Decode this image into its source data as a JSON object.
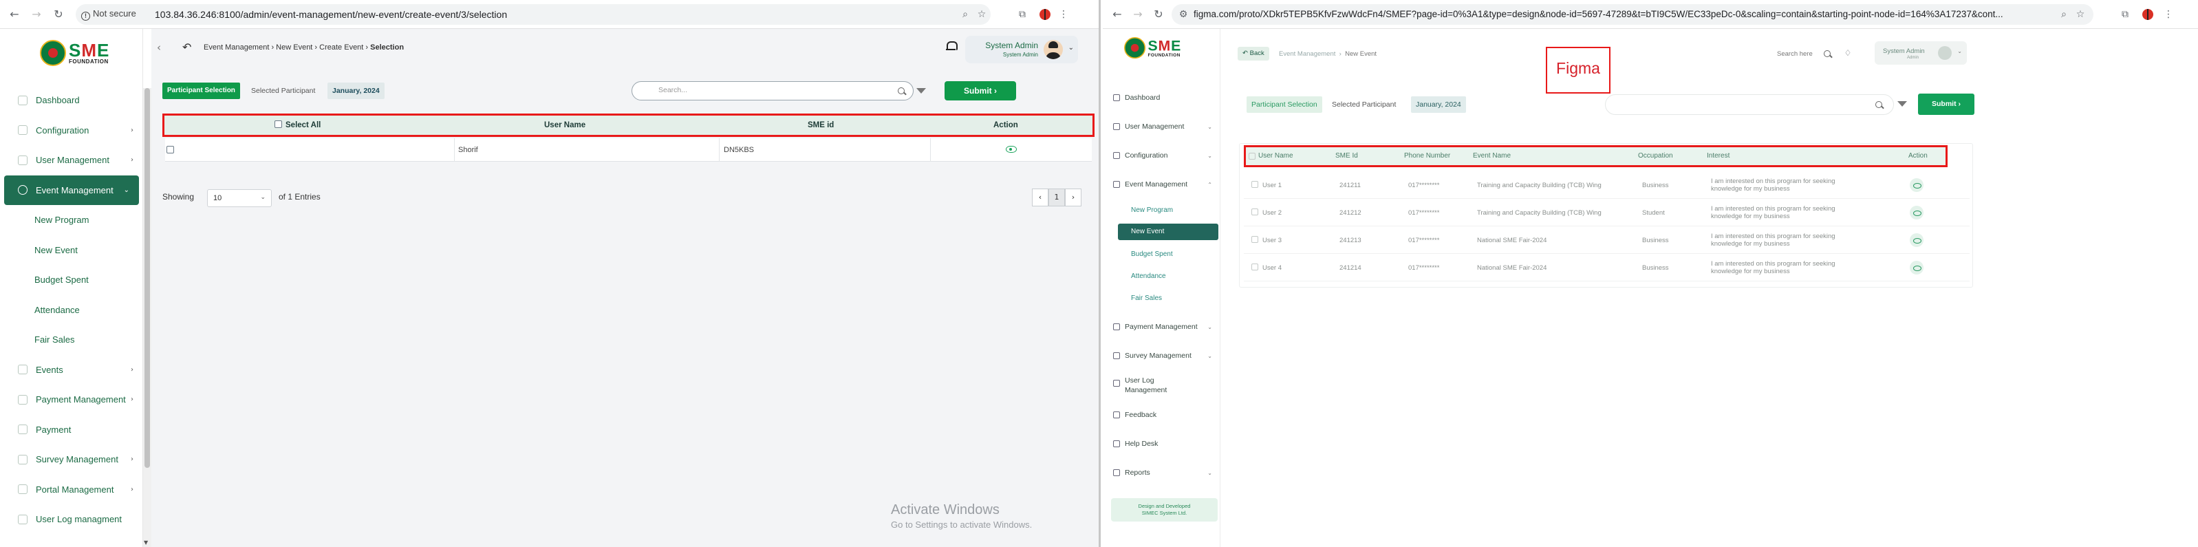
{
  "left_window": {
    "browser": {
      "security": "Not secure",
      "url": "103.84.36.246:8100/admin/event-management/new-event/create-event/3/selection"
    },
    "logo": {
      "brand": "SME",
      "tagline": "FOUNDATION"
    },
    "sidebar": {
      "items": [
        {
          "label": "Dashboard"
        },
        {
          "label": "Configuration",
          "chevron": "›"
        },
        {
          "label": "User Management",
          "chevron": "›"
        },
        {
          "label": "Event Management",
          "chevron": "⌄",
          "active": true
        }
      ],
      "subitems": [
        "New Program",
        "New Event",
        "Budget Spent",
        "Attendance",
        "Fair Sales"
      ],
      "items_after": [
        {
          "label": "Events",
          "chevron": "›"
        },
        {
          "label": "Payment Management",
          "chevron": "›"
        },
        {
          "label": "Payment"
        },
        {
          "label": "Survey Management",
          "chevron": "›"
        },
        {
          "label": "Portal Management",
          "chevron": "›"
        },
        {
          "label": "User Log managment"
        }
      ]
    },
    "header": {
      "breadcrumb": [
        "Event Management",
        "New Event",
        "Create Event",
        "Selection"
      ],
      "user_name": "System Admin",
      "user_role": "System Admin"
    },
    "tabs": {
      "participant_selection": "Participant Selection",
      "selected_participant": "Selected Participant",
      "date": "January, 2024"
    },
    "search": {
      "placeholder": "Search..."
    },
    "submit_label": "Submit",
    "table": {
      "select_all": "Select All",
      "columns": [
        "User Name",
        "SME id",
        "Action"
      ],
      "rows": [
        {
          "user_name": "Shorif",
          "sme_id": "DN5KBS"
        }
      ]
    },
    "pagination": {
      "showing_label": "Showing",
      "page_size": "10",
      "entries_text": "of 1 Entries",
      "current_page": "1"
    },
    "watermark": {
      "line1": "Activate Windows",
      "line2": "Go to Settings to activate Windows."
    }
  },
  "right_window": {
    "browser": {
      "url": "figma.com/proto/XDkr5TEPB5KfvFzwWdcFn4/SMEF?page-id=0%3A1&type=design&node-id=5697-47289&t=bTI9C5W/EC33peDc-0&scaling=contain&starting-point-node-id=164%3A17237&cont..."
    },
    "logo": {
      "brand": "SME",
      "tagline": "FOUNDATION"
    },
    "sidebar": {
      "items": [
        {
          "label": "Dashboard"
        },
        {
          "label": "User Management",
          "chevron": "⌄"
        },
        {
          "label": "Configuration",
          "chevron": "⌄"
        },
        {
          "label": "Event Management",
          "chevron": "⌃"
        }
      ],
      "subitems": [
        "New Program",
        "New Event",
        "Budget Spent",
        "Attendance",
        "Fair Sales"
      ],
      "active_subitem": "New Event",
      "items_after": [
        {
          "label": "Payment Management",
          "chevron": "⌄"
        },
        {
          "label": "Survey Management",
          "chevron": "⌄"
        },
        {
          "label": "User Log Management"
        },
        {
          "label": "Feedback"
        },
        {
          "label": "Help Desk"
        },
        {
          "label": "Reports",
          "chevron": "⌄"
        }
      ],
      "footer_line1": "Design and Developed",
      "footer_line2": "SIMEC System Ltd."
    },
    "header": {
      "back_label": "Back",
      "breadcrumb": [
        "Event Management",
        "New Event"
      ],
      "search_label": "Search here",
      "user_name": "System Admin",
      "user_role": "Admin"
    },
    "annotation": "Figma",
    "tabs": {
      "participant_selection": "Participant Selection",
      "selected_participant": "Selected Participant",
      "date": "January, 2024"
    },
    "submit_label": "Submit",
    "table": {
      "columns": [
        "User Name",
        "SME Id",
        "Phone Number",
        "Event Name",
        "Occupation",
        "Interest",
        "Action"
      ],
      "rows": [
        {
          "user": "User 1",
          "sme_id": "241211",
          "phone": "017********",
          "event": "Training and Capacity Building (TCB) Wing",
          "occupation": "Business",
          "interest_1": "I am interested on this program for seeking",
          "interest_2": "knowledge for my business"
        },
        {
          "user": "User 2",
          "sme_id": "241212",
          "phone": "017********",
          "event": "Training and Capacity Building (TCB) Wing",
          "occupation": "Student",
          "interest_1": "I am interested on this program for seeking",
          "interest_2": "knowledge for my business"
        },
        {
          "user": "User 3",
          "sme_id": "241213",
          "phone": "017********",
          "event": "National SME Fair-2024",
          "occupation": "Business",
          "interest_1": "I am interested on this program for seeking",
          "interest_2": "knowledge for my business"
        },
        {
          "user": "User 4",
          "sme_id": "241214",
          "phone": "017********",
          "event": "National SME Fair-2024",
          "occupation": "Business",
          "interest_1": "I am interested on this program for seeking",
          "interest_2": "knowledge for my business"
        }
      ]
    }
  },
  "colors": {
    "primary_green": "#0f9a4a",
    "active_sidebar": "#1f6e52",
    "annotation_red": "#e81919"
  }
}
